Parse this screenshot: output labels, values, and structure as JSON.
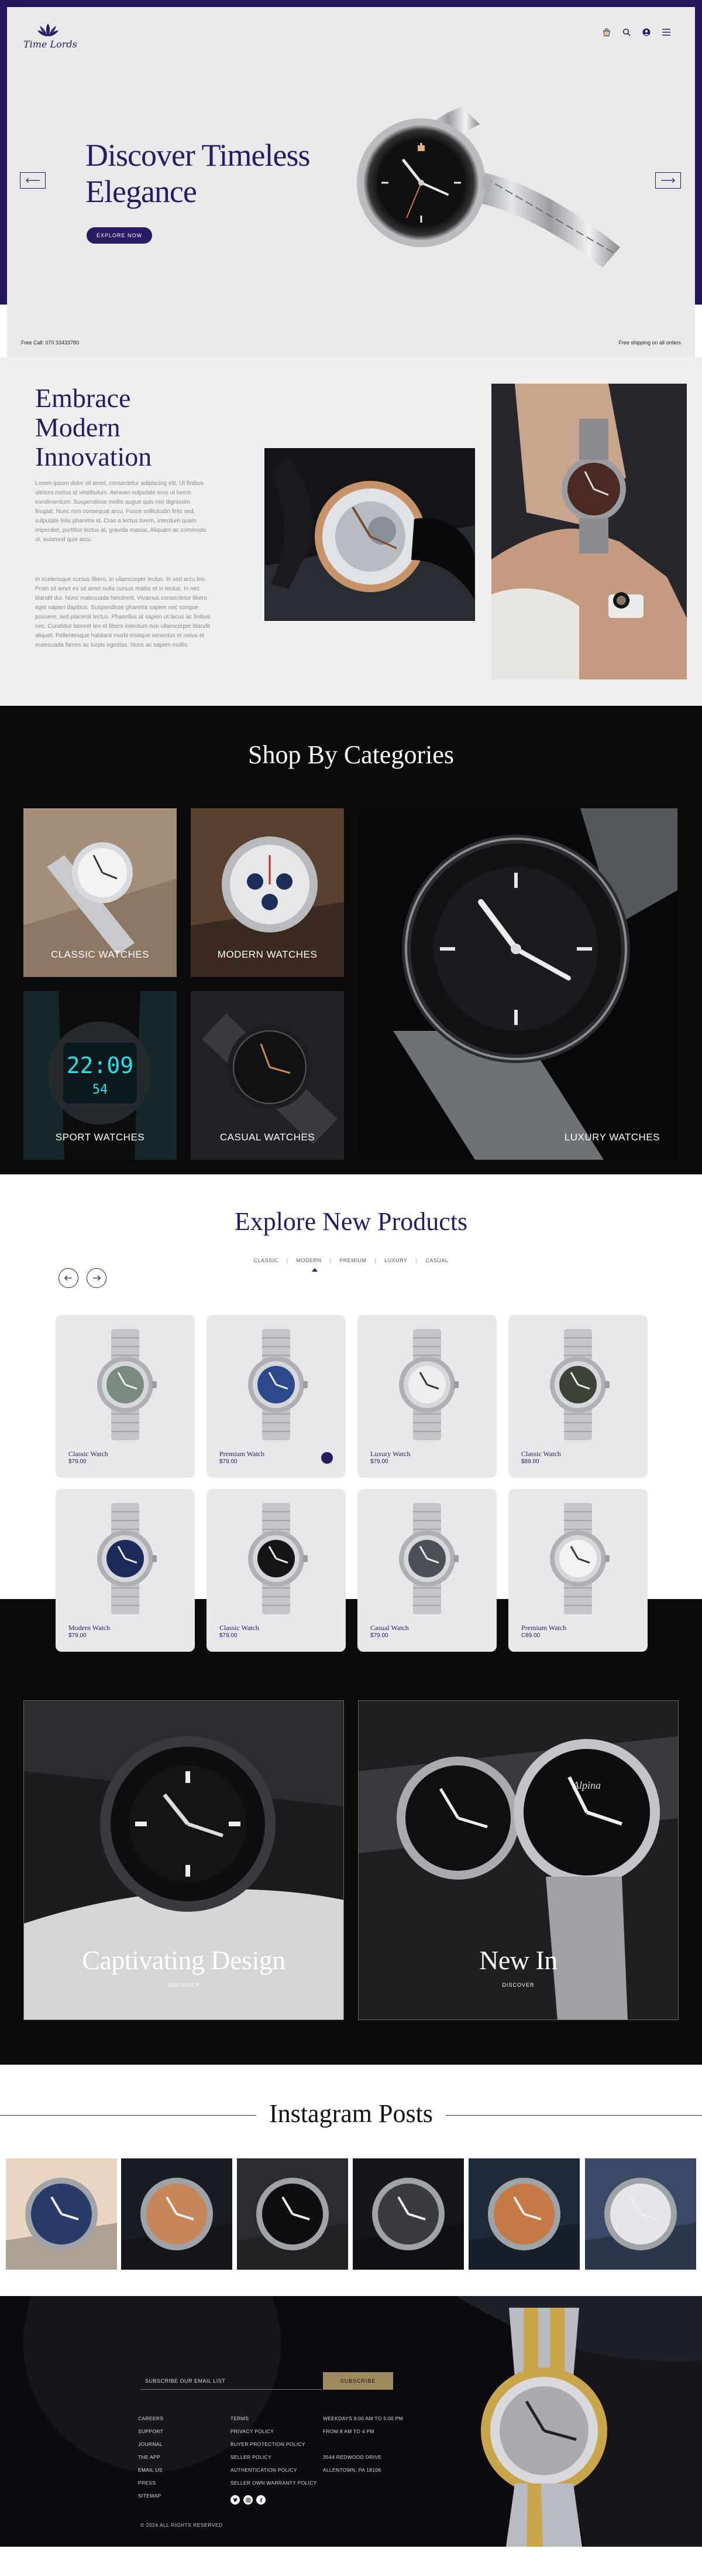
{
  "brand": {
    "name": "Time Lords",
    "accent": "#2a1a64",
    "gold": "#9e8a5c"
  },
  "hero": {
    "title": "Discover Timeless Elegance",
    "button": "EXPLORE NOW",
    "prev_icon": "arrow-left-icon",
    "next_icon": "arrow-right-icon"
  },
  "header_icons": [
    "bag-icon",
    "search-icon",
    "user-icon",
    "menu-icon"
  ],
  "strip": {
    "left": "Free Call: 070 33433780",
    "right": "Free shipping on all orders"
  },
  "embrace": {
    "title": "Embrace Modern Innovation",
    "para1": "Lorem ipsum dolor sit amet, consectetur adipiscing elit. Ut finibus ultrices metus id vestibulum. Aenean vulputate eros ut lorem condimentum. Suspendisse mollis augue quis nisi dignissim feugiat. Nunc non consequat arcu. Fusce sollicitudin felis sed, vulputate felis pharetra id. Cras a lectus lorem, interdum quam imperdiet, porttitor lectus at, gravida massa. Aliquam ac commodo ut, euismod quis arcu.",
    "para2": "In scelerisque cursus libero, in ullamcorper lectus. In sed arcu leo. Proin sit amet ex sit amet nulla cursus mattis et in lectus. In nec blandit dui. Nunc malesuada hendrerit. Vivamus consectetur libero eget sapien dapibus. Suspendisse pharetra sapien nec congue posuere, sed placerat lectus. Phasellus at sapien ut lacus ac finibus nec. Curabitur laoreet leo et libero interdum non ullamcorper blandit aliquet. Pellentesque habitant morbi tristique senectus et netus et malesuada fames ac turpis egestas. Nunc ac sapien mollis."
  },
  "categories": {
    "title": "Shop By Categories",
    "items": [
      "CLASSIC WATCHES",
      "MODERN WATCHES",
      "SPORT WATCHES",
      "CASUAL WATCHES",
      "LUXURY WATCHES"
    ]
  },
  "explore": {
    "title": "Explore New Products",
    "tabs": [
      "CLASSIC",
      "MODERN",
      "PREMIUM",
      "LUXURY",
      "CASUAL"
    ],
    "products": [
      {
        "name": "Classic Watch",
        "price": "$79.00"
      },
      {
        "name": "Premium Watch",
        "price": "$79.00"
      },
      {
        "name": "Luxury Watch",
        "price": "$79.00"
      },
      {
        "name": "Classic Watch",
        "price": "$89.00"
      },
      {
        "name": "Modern Watch",
        "price": "$79.00"
      },
      {
        "name": "Classic Watch",
        "price": "$79.00"
      },
      {
        "name": "Casual Watch",
        "price": "$79.00"
      },
      {
        "name": "Premium Watch",
        "price": "C89.00"
      }
    ]
  },
  "features": [
    {
      "title": "Captivating Design",
      "sub": "DISCOVER"
    },
    {
      "title": "New In",
      "sub": "DISCOVER"
    }
  ],
  "instagram": {
    "title": "Instagram Posts"
  },
  "footer": {
    "input_placeholder": "SUBSCRIBE OUR EMAIL LIST",
    "button": "SUBSCRIBE",
    "col1": [
      "CAREERS",
      "SUPPORT",
      "JOURNAL",
      "THE APP",
      "EMAIL US",
      "PRESS",
      "SITEMAP"
    ],
    "col2": [
      "TERMS",
      "PRIVACY POLICY",
      "BUYER PROTECTION POLICY",
      "SELLER POLICY",
      "AUTHENTICATION POLICY",
      "SELLER OWN WARRANTY POLICY"
    ],
    "col3": [
      "WEEKDAYS 9:00 AM TO 5:00 PM",
      "FROM 8 AM TO 4 PM",
      "",
      "3544 REDWOOD DRIVE",
      "ALLENTOWN, PA 18106"
    ],
    "social": [
      "twitter-icon",
      "instagram-icon",
      "facebook-icon"
    ],
    "copyright": "© 2024 ALL RIGHTS RESERVED"
  }
}
